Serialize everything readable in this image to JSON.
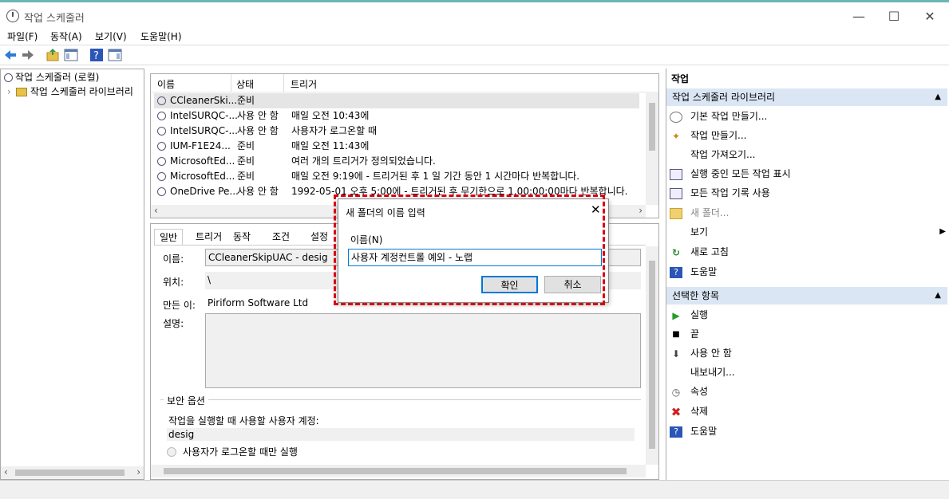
{
  "window": {
    "title": "작업 스케줄러",
    "min": "—",
    "max": "☐",
    "close": "✕"
  },
  "menu": [
    "파일(F)",
    "동작(A)",
    "보기(V)",
    "도움말(H)"
  ],
  "tree": {
    "root": "작업 스케줄러 (로컬)",
    "child": "작업 스케줄러 라이브러리"
  },
  "task_list": {
    "columns": [
      "이름",
      "상태",
      "트리거"
    ],
    "rows": [
      {
        "name": "CCleanerSki...",
        "status": "준비",
        "trigger": ""
      },
      {
        "name": "IntelSURQC-...",
        "status": "사용 안 함",
        "trigger": "매일 오전 10:43에"
      },
      {
        "name": "IntelSURQC-...",
        "status": "사용 안 함",
        "trigger": "사용자가 로그온할 때"
      },
      {
        "name": "IUM-F1E24...",
        "status": "준비",
        "trigger": "매일 오전 11:43에"
      },
      {
        "name": "MicrosoftEd...",
        "status": "준비",
        "trigger": "여러 개의 트리거가 정의되었습니다."
      },
      {
        "name": "MicrosoftEd...",
        "status": "준비",
        "trigger": "매일 오전 9:19에 - 트리거된 후 1 일 기간 동안 1 시간마다 반복합니다."
      },
      {
        "name": "OneDrive Pe...",
        "status": "사용 안 함",
        "trigger": "1992-05-01 오후 5:00에 - 트리거된 후 무기한으로 1.00:00:00마다 반복합니다."
      }
    ]
  },
  "detail": {
    "tabs": [
      "일반",
      "트리거",
      "동작",
      "조건",
      "설정"
    ],
    "name_label": "이름:",
    "name_value": "CCleanerSkipUAC - desig",
    "location_label": "위치:",
    "location_value": "\\",
    "author_label": "만든 이:",
    "author_value": "Piriform Software Ltd",
    "desc_label": "설명:",
    "security_title": "보안 옵션",
    "account_label": "작업을 실행할 때 사용할 사용자 계정:",
    "account_value": "desig",
    "radio_label": "사용자가 로그온할 때만 실행"
  },
  "actions": {
    "header": "작업",
    "lib_section": "작업 스케줄러 라이브러리",
    "lib_items": [
      "기본 작업 만들기...",
      "작업 만들기...",
      "작업 가져오기...",
      "실행 중인 모든 작업 표시",
      "모든 작업 기록 사용",
      "새 폴더...",
      "보기",
      "새로 고침",
      "도움말"
    ],
    "sel_section": "선택한 항목",
    "sel_items": [
      "실행",
      "끝",
      "사용 안 함",
      "내보내기...",
      "속성",
      "삭제",
      "도움말"
    ]
  },
  "dialog": {
    "title": "새 폴더의 이름 입력",
    "label": "이름(N)",
    "input_value": "사용자 계정컨트롤 예외 - 노랩",
    "ok": "확인",
    "cancel": "취소",
    "close": "✕"
  },
  "colors": {
    "accent_red": "#d80012",
    "section_bg": "#dbe6f4",
    "selected_row": "#e5e5e5"
  }
}
